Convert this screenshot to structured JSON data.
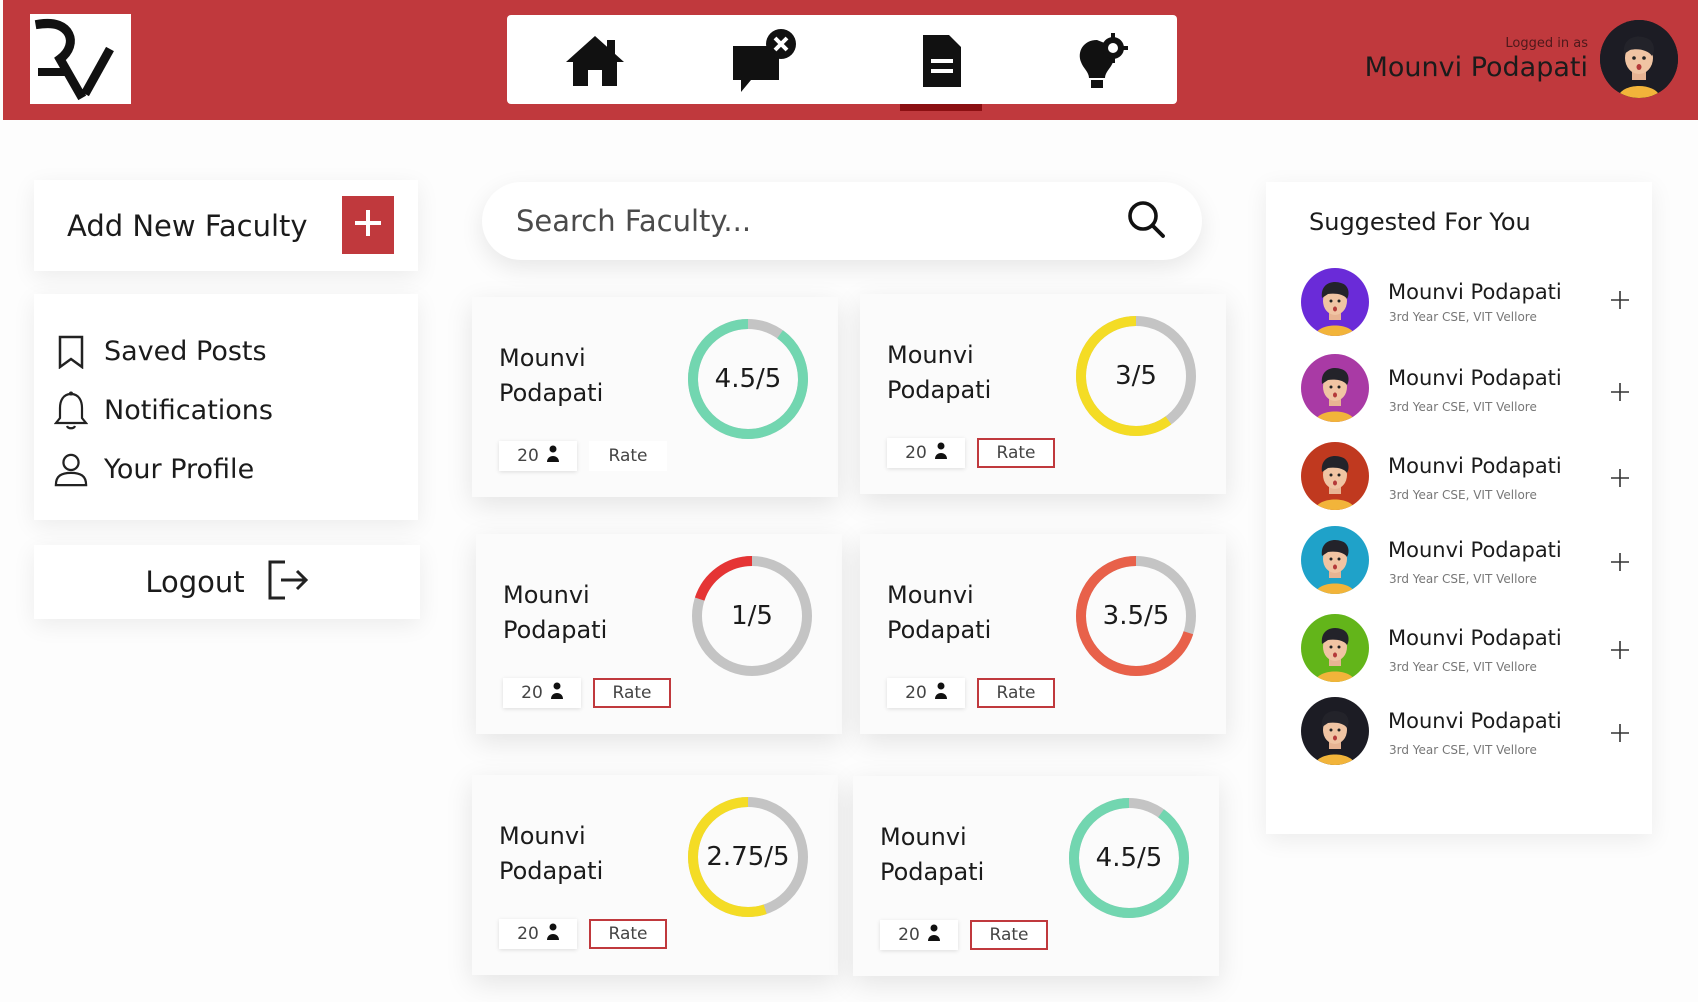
{
  "header": {
    "logged_in_caption": "Logged in as",
    "user_name": "Mounvi Podapati",
    "brand_color": "#c0393d",
    "nav_tabs": [
      {
        "icon": "home-icon",
        "active": false
      },
      {
        "icon": "chat-close-icon",
        "active": false
      },
      {
        "icon": "document-icon",
        "active": true
      },
      {
        "icon": "lightbulb-gear-icon",
        "active": false
      }
    ]
  },
  "sidebar": {
    "add_faculty_label": "Add New Faculty",
    "menu": [
      {
        "label": "Saved Posts",
        "icon": "bookmark-icon"
      },
      {
        "label": "Notifications",
        "icon": "bell-icon"
      },
      {
        "label": "Your Profile",
        "icon": "profile-icon"
      }
    ],
    "logout_label": "Logout"
  },
  "search": {
    "placeholder": "Search Faculty..."
  },
  "faculty_cards": [
    {
      "first": "Mounvi",
      "last": "Podapati",
      "rating": "4.5/5",
      "score": 4.5,
      "color": "#72d6b0",
      "count": "20",
      "rate_label": "Rate",
      "rate_boxed": false
    },
    {
      "first": "Mounvi",
      "last": "Podapati",
      "rating": "3/5",
      "score": 3,
      "color": "#f4dc25",
      "count": "20",
      "rate_label": "Rate",
      "rate_boxed": true
    },
    {
      "first": "Mounvi",
      "last": "Podapati",
      "rating": "1/5",
      "score": 1,
      "color": "#e53434",
      "count": "20",
      "rate_label": "Rate",
      "rate_boxed": true
    },
    {
      "first": "Mounvi",
      "last": "Podapati",
      "rating": "3.5/5",
      "score": 3.5,
      "color": "#e8614a",
      "count": "20",
      "rate_label": "Rate",
      "rate_boxed": true
    },
    {
      "first": "Mounvi",
      "last": "Podapati",
      "rating": "2.75/5",
      "score": 2.75,
      "color": "#f4dc25",
      "count": "20",
      "rate_label": "Rate",
      "rate_boxed": true
    },
    {
      "first": "Mounvi",
      "last": "Podapati",
      "rating": "4.5/5",
      "score": 4.5,
      "color": "#72d6b0",
      "count": "20",
      "rate_label": "Rate",
      "rate_boxed": true
    }
  ],
  "suggestions": {
    "title": "Suggested For You",
    "items": [
      {
        "name": "Mounvi Podapati",
        "subtitle": "3rd Year CSE, VIT Vellore",
        "avatar_color": "#6a2bd8"
      },
      {
        "name": "Mounvi Podapati",
        "subtitle": "3rd Year CSE, VIT Vellore",
        "avatar_color": "#a93aa5"
      },
      {
        "name": "Mounvi Podapati",
        "subtitle": "3rd Year CSE, VIT Vellore",
        "avatar_color": "#c0391f"
      },
      {
        "name": "Mounvi Podapati",
        "subtitle": "3rd Year CSE, VIT Vellore",
        "avatar_color": "#1fa2c9"
      },
      {
        "name": "Mounvi Podapati",
        "subtitle": "3rd Year CSE, VIT Vellore",
        "avatar_color": "#63b51a"
      },
      {
        "name": "Mounvi Podapati",
        "subtitle": "3rd Year CSE, VIT Vellore",
        "avatar_color": "#1c1c24"
      }
    ]
  }
}
